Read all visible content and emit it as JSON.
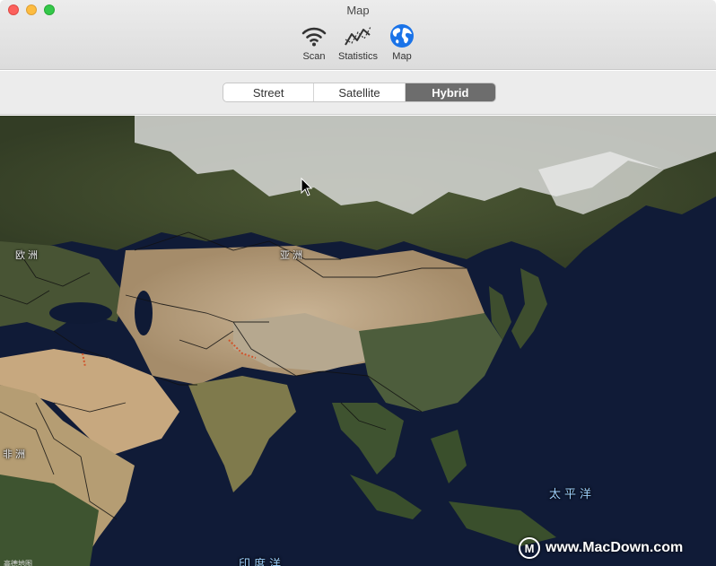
{
  "window": {
    "title": "Map"
  },
  "toolbar": {
    "items": [
      {
        "label": "Scan",
        "icon": "wifi-icon"
      },
      {
        "label": "Statistics",
        "icon": "statistics-icon"
      },
      {
        "label": "Map",
        "icon": "globe-icon"
      }
    ]
  },
  "map_type": {
    "options": [
      "Street",
      "Satellite",
      "Hybrid"
    ],
    "selected": "Hybrid"
  },
  "map": {
    "labels": {
      "europe": "欧洲",
      "asia": "亚洲",
      "africa": "非洲",
      "pacific": "太平洋",
      "indian_ocean": "印度洋"
    },
    "credit": "高德地图"
  },
  "watermark": {
    "text": "www.MacDown.com",
    "logo": "M"
  },
  "colors": {
    "accent": "#1a73e8",
    "selected_segment": "#6d6d6d",
    "ocean": "#101b37"
  }
}
